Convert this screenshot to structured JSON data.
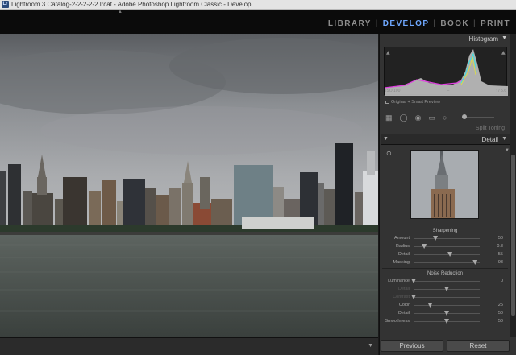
{
  "window": {
    "title": "Lightroom 3 Catalog-2-2-2-2-2.lrcat - Adobe Photoshop Lightroom Classic - Develop"
  },
  "modules": [
    {
      "label": "LIBRARY",
      "active": false
    },
    {
      "label": "DEVELOP",
      "active": true
    },
    {
      "label": "BOOK",
      "active": false
    },
    {
      "label": "PRINT",
      "active": false
    }
  ],
  "histogram": {
    "title": "Histogram",
    "iso": "ISO 100",
    "dash": "–",
    "aperture": "f / 5.6",
    "preview_label": "Original + Smart Preview"
  },
  "split_toning": {
    "label": "Split Toning"
  },
  "detail": {
    "title": "Detail",
    "sharpening": {
      "title": "Sharpening",
      "rows": [
        {
          "label": "Amount",
          "value": "50",
          "pos": 0.33
        },
        {
          "label": "Radius",
          "value": "0.8",
          "pos": 0.16
        },
        {
          "label": "Detail",
          "value": "55",
          "pos": 0.55
        },
        {
          "label": "Masking",
          "value": "93",
          "pos": 0.93
        }
      ]
    },
    "noise_reduction": {
      "title": "Noise Reduction",
      "rows": [
        {
          "label": "Luminance",
          "value": "0",
          "pos": 0.0,
          "dim": false
        },
        {
          "label": "Detail",
          "value": "",
          "pos": 0.5,
          "dim": true
        },
        {
          "label": "Contrast",
          "value": "",
          "pos": 0.0,
          "dim": true
        },
        {
          "label": "Color",
          "value": "25",
          "pos": 0.25,
          "dim": false
        },
        {
          "label": "Detail",
          "value": "50",
          "pos": 0.5,
          "dim": false
        },
        {
          "label": "Smoothness",
          "value": "50",
          "pos": 0.5,
          "dim": false
        }
      ]
    }
  },
  "buttons": {
    "previous": "Previous",
    "reset": "Reset"
  }
}
